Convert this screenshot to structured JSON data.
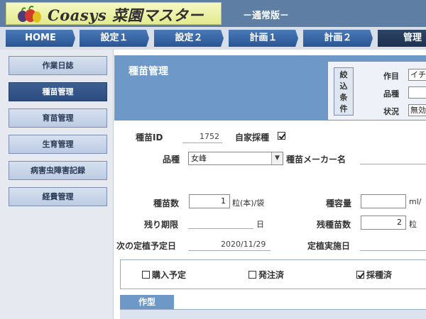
{
  "header": {
    "logo_text": "Coasys 菜園マスター",
    "edition": "－通常版－"
  },
  "nav": {
    "tabs": [
      {
        "label": "HOME"
      },
      {
        "label": "設定１"
      },
      {
        "label": "設定２"
      },
      {
        "label": "計画１"
      },
      {
        "label": "計画２"
      },
      {
        "label": "管理"
      }
    ],
    "active": "管理"
  },
  "sidebar": {
    "items": [
      {
        "label": "作業日誌"
      },
      {
        "label": "種苗管理"
      },
      {
        "label": "育苗管理"
      },
      {
        "label": "生育管理"
      },
      {
        "label": "病害虫障害記録"
      },
      {
        "label": "経費管理"
      }
    ],
    "active": "種苗管理"
  },
  "main": {
    "title": "種苗管理",
    "filter": {
      "label": "絞込条件",
      "crop_label": "作目",
      "crop_value": "イチ",
      "variety_label": "品種",
      "variety_value": "",
      "status_label": "状況",
      "status_value": "無効"
    },
    "form": {
      "seed_id_label": "種苗ID",
      "seed_id_value": "1752",
      "self_seed_label": "自家採種",
      "self_seed_checked": true,
      "variety_label": "品種",
      "variety_value": "女峰",
      "maker_label": "種苗メーカー名",
      "maker_value": "",
      "count_label": "種苗数",
      "count_value": "1",
      "count_unit": "粒(本)/袋",
      "capacity_label": "種容量",
      "capacity_value": "",
      "capacity_unit": "ml/",
      "remaining_label": "残り期限",
      "remaining_value": "",
      "remaining_unit": "日",
      "remaining_count_label": "残種苗数",
      "remaining_count_value": "2",
      "remaining_count_unit": "粒",
      "next_plant_label": "次の定植予定日",
      "next_plant_value": "2020/11/29",
      "planted_label": "定植実施日",
      "planted_value": ""
    },
    "status": {
      "purchase_label": "購入予定",
      "purchase_checked": false,
      "ordered_label": "発注済",
      "ordered_checked": false,
      "collected_label": "採種済",
      "collected_checked": true
    },
    "sakugata_label": "作型"
  },
  "colors": {
    "header_bg": "#5f7ea3",
    "nav_tab": "#2a5593",
    "title_band": "#6e98c8",
    "sidebar_active": "#2a4c80"
  }
}
